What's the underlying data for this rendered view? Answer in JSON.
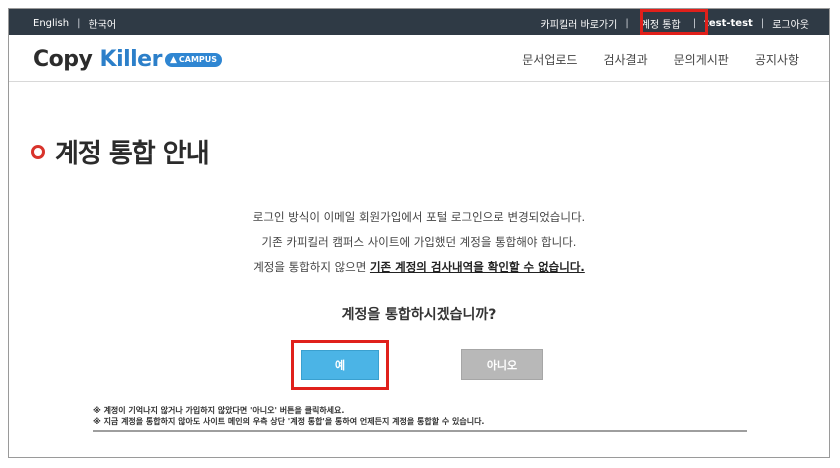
{
  "topbar": {
    "lang_en": "English",
    "lang_ko": "한국어",
    "shortcut": "카피킬러 바로가기",
    "account_merge": "계정 통합",
    "user": "test-test",
    "logout": "로그아웃",
    "separator": "|"
  },
  "logo": {
    "part1": "Copy ",
    "part2": "Killer",
    "badge": "CAMPUS"
  },
  "nav": {
    "upload": "문서업로드",
    "results": "검사결과",
    "qna": "문의게시판",
    "notice": "공지사항"
  },
  "page": {
    "title": "계정 통합 안내",
    "line1": "로그인 방식이 이메일 회원가입에서 포털 로그인으로 변경되었습니다.",
    "line2": "기존 카피킬러 캠퍼스 사이트에 가입했던 계정을 통합해야 합니다.",
    "line3_prefix": "계정을 통합하지 않으면 ",
    "line3_emph": "기존 계정의 검사내역을 확인할 수 없습니다.",
    "question": "계정을 통합하시겠습니까?",
    "yes": "예",
    "no": "아니오",
    "note1": "※ 계정이 기억나지 않거나 가입하지 않았다면 '아니오' 버튼을 클릭하세요.",
    "note2": "※ 지금 계정을 통합하지 않아도 사이트 메인의 우측 상단 '계정 통합'을 통하여 언제든지 계정을 통합할 수 있습니다."
  },
  "colors": {
    "topbar": "#2f3a45",
    "accent": "#e0201b",
    "yes_button": "#4bb4e6",
    "no_button": "#b8b8b8"
  }
}
